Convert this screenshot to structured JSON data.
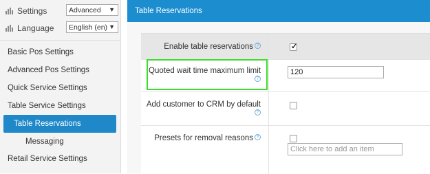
{
  "sidebar": {
    "settings": {
      "label": "Settings",
      "value": "Advanced"
    },
    "language": {
      "label": "Language",
      "value": "English (en)"
    },
    "items": [
      {
        "label": "Basic Pos Settings"
      },
      {
        "label": "Advanced Pos Settings"
      },
      {
        "label": "Quick Service Settings"
      },
      {
        "label": "Table Service Settings"
      },
      {
        "label": "Table Reservations"
      },
      {
        "label": "Messaging"
      },
      {
        "label": "Retail Service Settings"
      }
    ]
  },
  "header": {
    "title": "Table Reservations"
  },
  "form": {
    "enable": {
      "label": "Enable table reservations",
      "checked": true
    },
    "wait_time": {
      "label": "Quoted wait time maximum limit",
      "value": "120"
    },
    "crm": {
      "label": "Add customer to CRM by default",
      "checked": false
    },
    "presets": {
      "label": "Presets for removal reasons",
      "placeholder": "Click here to add an item",
      "checked": false
    }
  },
  "colors": {
    "accent": "#1c8ed0",
    "highlight": "#3cdc2a"
  }
}
